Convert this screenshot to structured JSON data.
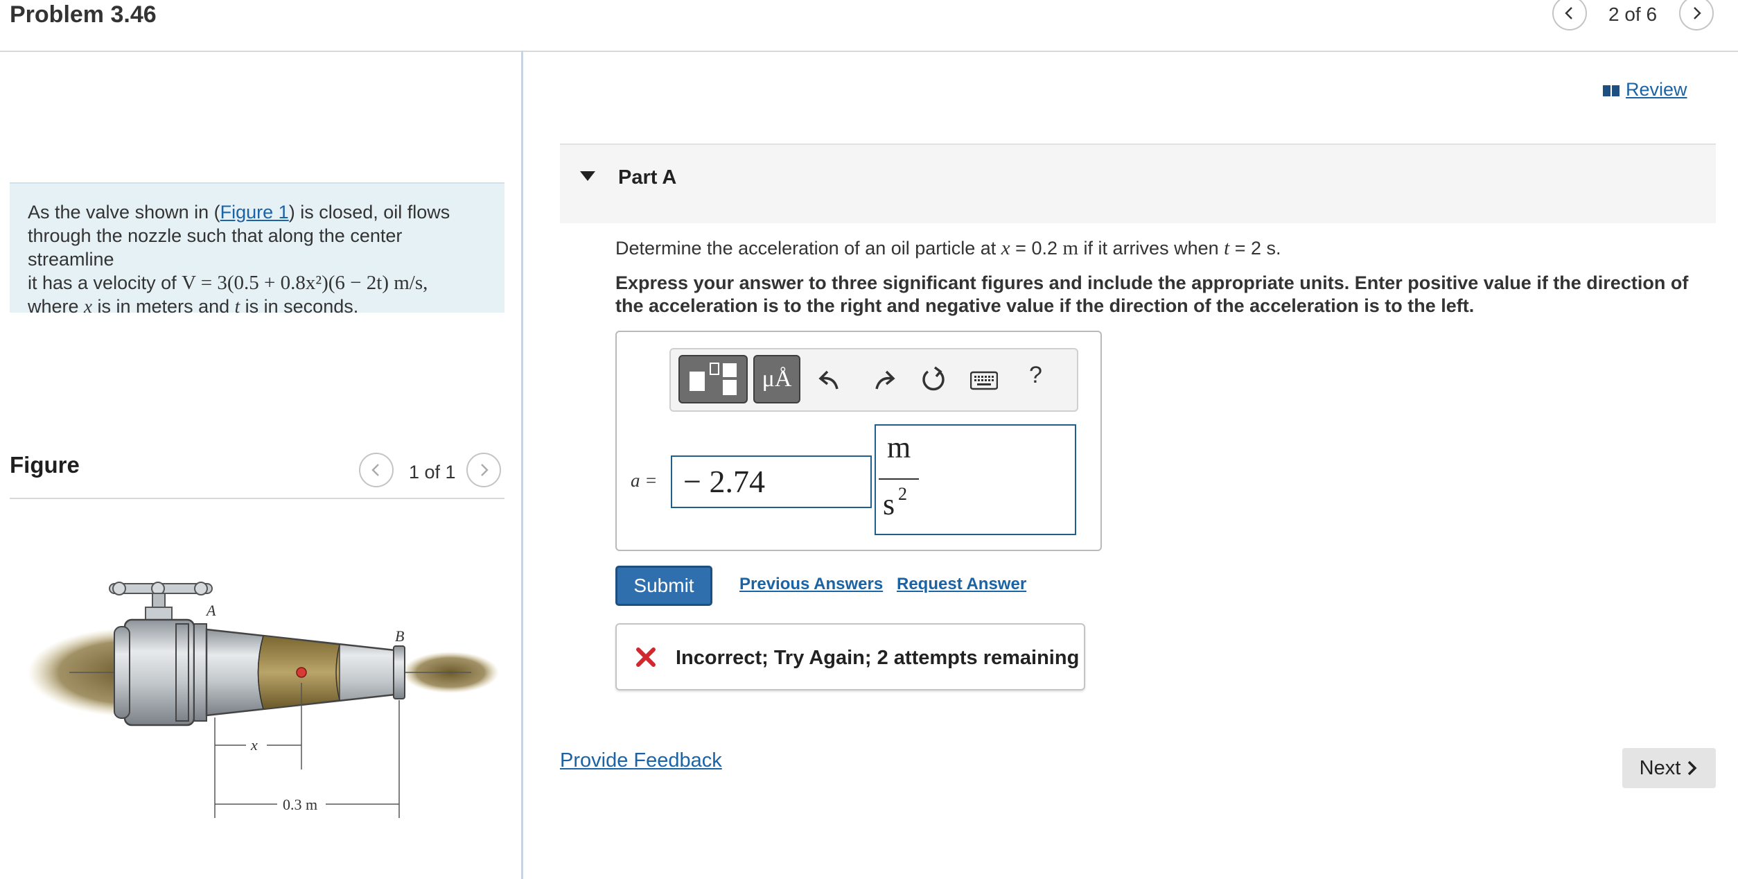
{
  "header": {
    "title": "Problem 3.46",
    "counter": "2 of 6"
  },
  "intro": {
    "text_before_link": "As the valve shown in (",
    "figure_link": "Figure 1",
    "text_line1_rest": ") is closed, oil flows",
    "line2": "through the nozzle such that along the center streamline",
    "line3_prefix": "it has a velocity of ",
    "velocity_equation": "V = 3(0.5 + 0.8x²)(6 − 2t) m/s,",
    "line4_a": "where ",
    "line4_x": "x",
    "line4_b": " is in meters and ",
    "line4_t": "t",
    "line4_c": " is in seconds."
  },
  "figure": {
    "label": "Figure",
    "counter": "1 of 1",
    "point_a": "A",
    "point_b": "B",
    "dim_x": "x",
    "dim_length": "0.3 m"
  },
  "review": {
    "label": "Review"
  },
  "part": {
    "label": "Part A",
    "question_a": "Determine the acceleration of an oil particle at ",
    "question_x": "x",
    "question_b": " = 0.2 ",
    "question_m": "m",
    "question_c": " if it arrives when ",
    "question_t": "t",
    "question_d": " = 2 s.",
    "instructions": "Express your answer to three significant figures and include the appropriate units. Enter positive value if the direction of the acceleration is to the right and negative value if the direction of the acceleration is to the left."
  },
  "toolbar": {
    "mu_label": "μÅ",
    "help_label": "?",
    "icons": [
      "templates-icon",
      "mu-angstrom-icon",
      "undo-icon",
      "redo-icon",
      "reset-icon",
      "keyboard-icon",
      "help-icon"
    ]
  },
  "answer": {
    "variable_label": "a =",
    "value": "− 2.74",
    "unit_numerator": "m",
    "unit_denominator": "s",
    "unit_exponent": "2"
  },
  "actions": {
    "submit": "Submit",
    "previous_answers": "Previous Answers",
    "request_answer": "Request Answer"
  },
  "feedback": {
    "message": "Incorrect; Try Again; 2 attempts remaining",
    "status_color": "#d0282e"
  },
  "footer": {
    "provide_feedback": "Provide Feedback",
    "next": "Next"
  },
  "colors": {
    "link": "#1a63a5",
    "submit_bg": "#2f6fae",
    "intro_bg": "#e6f1f5"
  }
}
